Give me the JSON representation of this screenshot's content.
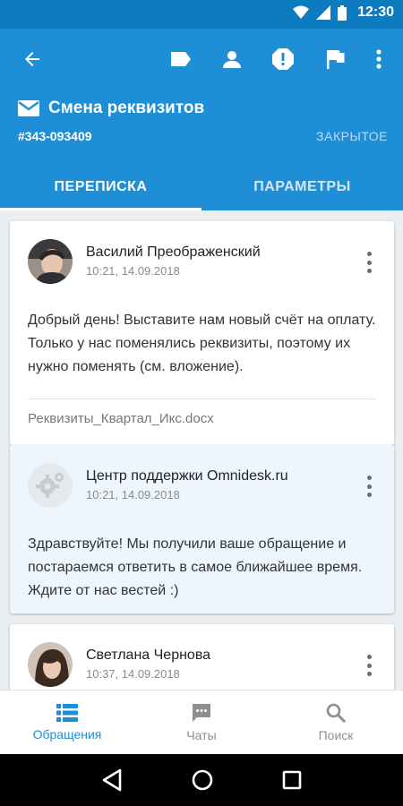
{
  "status_bar": {
    "time": "12:30"
  },
  "header": {
    "title": "Смена реквизитов",
    "ticket_id": "#343-093409",
    "status": "ЗАКРЫТОЕ"
  },
  "tabs": [
    {
      "label": "ПЕРЕПИСКА",
      "active": true
    },
    {
      "label": "ПАРАМЕТРЫ",
      "active": false
    }
  ],
  "messages": [
    {
      "author": "Василий Преображенский",
      "datetime": "10:21, 14.09.2018",
      "text": "Добрый день! Выставите нам новый счёт на оплату. Только у нас поменялись реквизиты, поэтому их нужно поменять (см. вложение).",
      "attachment": "Реквизиты_Квартал_Икс.docx"
    },
    {
      "author": "Центр поддержки Omnidesk.ru",
      "datetime": "10:21, 14.09.2018",
      "text": "Здравствуйте! Мы получили ваше обращение и постараемся ответить в самое ближайшее время. Ждите от нас вестей :)"
    },
    {
      "author": "Светлана Чернова",
      "datetime": "10:37, 14.09.2018"
    }
  ],
  "bottom_nav": [
    {
      "label": "Обращения",
      "icon": "list-icon",
      "active": true
    },
    {
      "label": "Чаты",
      "icon": "chat-icon",
      "active": false
    },
    {
      "label": "Поиск",
      "icon": "search-icon",
      "active": false
    }
  ],
  "colors": {
    "primary": "#1e8fd6",
    "status_bar": "#0d7bc0",
    "support_card": "#eef6fd"
  }
}
